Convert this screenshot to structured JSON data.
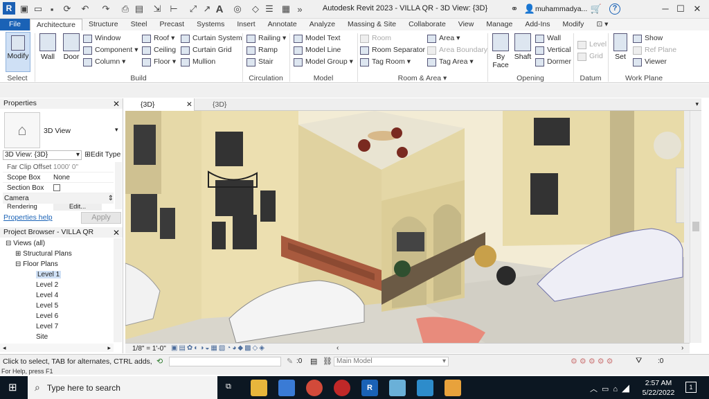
{
  "window": {
    "title": "Autodesk Revit 2023 - VILLA QR - 3D View: {3D}",
    "user": "muhammadya...",
    "help_icon": "?"
  },
  "tabs": [
    "File",
    "Architecture",
    "Structure",
    "Steel",
    "Precast",
    "Systems",
    "Insert",
    "Annotate",
    "Analyze",
    "Massing & Site",
    "Collaborate",
    "View",
    "Manage",
    "Add-Ins",
    "Modify"
  ],
  "ribbon": {
    "select": {
      "modify": "Modify",
      "panel": "Select"
    },
    "build": {
      "panel": "Build",
      "wall": "Wall",
      "door": "Door",
      "window": "Window",
      "component": "Component",
      "column": "Column",
      "roof": "Roof",
      "ceiling": "Ceiling",
      "floor": "Floor",
      "curtain_system": "Curtain System",
      "curtain_grid": "Curtain Grid",
      "mullion": "Mullion"
    },
    "circulation": {
      "panel": "Circulation",
      "railing": "Railing",
      "ramp": "Ramp",
      "stair": "Stair"
    },
    "model": {
      "panel": "Model",
      "text": "Model Text",
      "line": "Model Line",
      "group": "Model Group"
    },
    "room_area": {
      "panel": "Room & Area",
      "room": "Room",
      "separator": "Room Separator",
      "tag_room": "Tag Room",
      "area": "Area",
      "area_boundary": "Area Boundary",
      "tag_area": "Tag Area"
    },
    "opening": {
      "panel": "Opening",
      "by_face": "By Face",
      "shaft": "Shaft",
      "wall": "Wall",
      "vertical": "Vertical",
      "dormer": "Dormer"
    },
    "datum": {
      "panel": "Datum",
      "level": "Level",
      "grid": "Grid"
    },
    "work_plane": {
      "panel": "Work Plane",
      "set": "Set",
      "show": "Show",
      "ref_plane": "Ref Plane",
      "viewer": "Viewer"
    }
  },
  "properties": {
    "title": "Properties",
    "type": "3D View",
    "selector": "3D View: {3D}",
    "edit_type": "Edit Type",
    "rows": [
      {
        "label": "Far Clip Offset",
        "value": "1000'  0\""
      },
      {
        "label": "Scope Box",
        "value": "None"
      },
      {
        "label": "Section Box",
        "value": ""
      }
    ],
    "group": "Camera",
    "render_label": "Rendering Set...",
    "render_value": "Edit...",
    "help": "Properties help",
    "apply": "Apply"
  },
  "browser": {
    "title": "Project Browser - VILLA QR",
    "items": [
      {
        "label": "Views (all)"
      },
      {
        "label": "Structural Plans"
      },
      {
        "label": "Floor Plans"
      },
      {
        "label": "Level 1"
      },
      {
        "label": "Level 2"
      },
      {
        "label": "Level 4"
      },
      {
        "label": "Level 5"
      },
      {
        "label": "Level 6"
      },
      {
        "label": "Level 7"
      },
      {
        "label": "Site"
      }
    ]
  },
  "viewtabs": [
    {
      "label": "{3D}"
    },
    {
      "label": "{3D}"
    }
  ],
  "viewbar": {
    "scale": "1/8\" = 1'-0\""
  },
  "status": {
    "message": "Click to select, TAB for alternates, CTRL adds, SHIFT u",
    "count": ":0",
    "model": "Main Model",
    "filter": ":0",
    "help": "For Help, press F1"
  },
  "taskbar": {
    "search": "Type here to search",
    "time": "2:57 AM",
    "date": "5/22/2022",
    "notifications": "1"
  },
  "colors": {
    "accent": "#1a62b6",
    "taskbar": "#0c1722",
    "viewport_bg": "#f3ecd5"
  }
}
